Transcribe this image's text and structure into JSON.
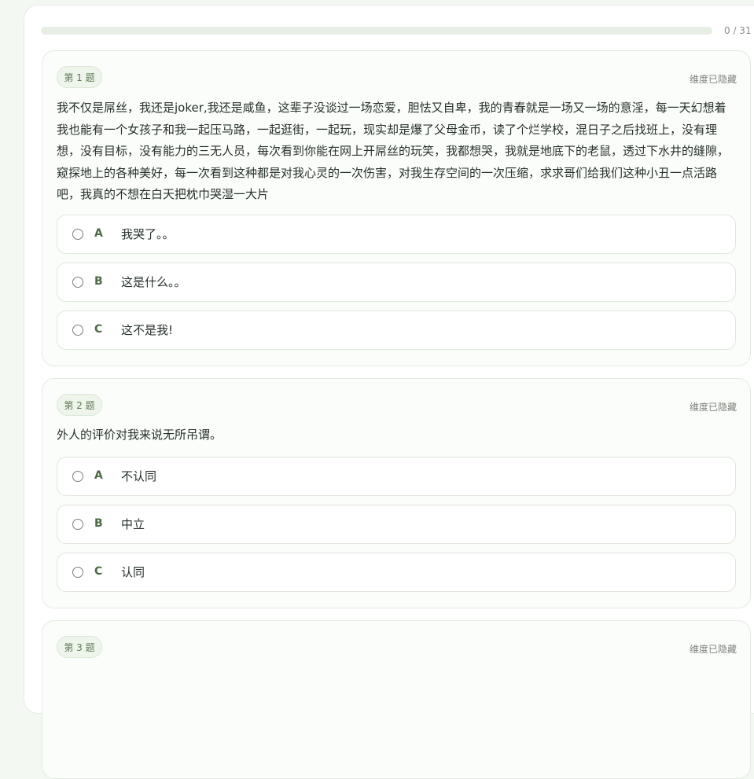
{
  "progress": {
    "answered": 0,
    "total": 31,
    "label": "0 / 31",
    "fraction": 0
  },
  "questions": [
    {
      "badge": "第 1 题",
      "dimension_label": "维度已隐藏",
      "text": "我不仅是屌丝，我还是joker,我还是咸鱼，这辈子没谈过一场恋爱，胆怯又自卑，我的青春就是一场又一场的意淫，每一天幻想着我也能有一个女孩子和我一起压马路，一起逛街，一起玩，现实却是爆了父母金币，读了个烂学校，混日子之后找班上，没有理想，没有目标，没有能力的三无人员，每次看到你能在网上开屌丝的玩笑，我都想哭，我就是地底下的老鼠，透过下水井的缝隙，窥探地上的各种美好，每一次看到这种都是对我心灵的一次伤害，对我生存空间的一次压缩，求求哥们给我们这种小丑一点活路吧，我真的不想在白天把枕巾哭湿一大片",
      "options": [
        {
          "key": "A",
          "label": "我哭了。。"
        },
        {
          "key": "B",
          "label": "这是什么。。"
        },
        {
          "key": "C",
          "label": "这不是我!"
        }
      ]
    },
    {
      "badge": "第 2 题",
      "dimension_label": "维度已隐藏",
      "text": "外人的评价对我来说无所吊谓。",
      "options": [
        {
          "key": "A",
          "label": "不认同"
        },
        {
          "key": "B",
          "label": "中立"
        },
        {
          "key": "C",
          "label": "认同"
        }
      ]
    },
    {
      "badge": "第 3 题",
      "dimension_label": "维度已隐藏"
    }
  ],
  "colors": {
    "accent": "#4e6a47",
    "badge_bg": "#eef5eb",
    "page_bg": "#f3f8f2",
    "progress_track": "#e7efe5"
  },
  "icons": {
    "radio": "radio-unchecked-icon"
  }
}
